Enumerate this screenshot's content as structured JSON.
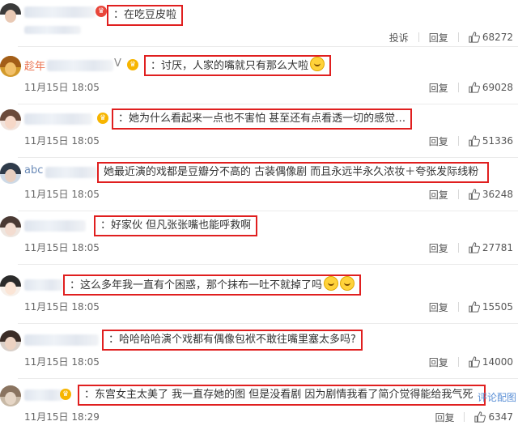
{
  "comments": [
    {
      "text": "在吃豆皮啦",
      "prefix": "：",
      "date": "",
      "likes": "68272",
      "show_report": true,
      "report": "投诉",
      "reply": "回复",
      "emoji": false
    },
    {
      "name": "趁年",
      "name_tail": "V",
      "text": "讨厌，人家的嘴就只有那么大啦",
      "prefix": "：",
      "date": "11月15日 18:05",
      "likes": "69028",
      "reply": "回复",
      "emoji": true
    },
    {
      "text": "她为什么看起来一点也不害怕 甚至还有点看透一切的感觉…",
      "prefix": "：",
      "date": "11月15日 18:05",
      "likes": "51336",
      "reply": "回复",
      "emoji": false
    },
    {
      "name": "abc",
      "text": "她最近演的戏都是豆瓣分不高的 古装偶像剧 而且永远半永久浓妆＋夸张发际线粉",
      "prefix": "",
      "date": "11月15日 18:05",
      "likes": "36248",
      "reply": "回复",
      "emoji": false
    },
    {
      "text": "好家伙 但凡张张嘴也能呼救啊",
      "prefix": "：",
      "date": "11月15日 18:05",
      "likes": "27781",
      "reply": "回复",
      "emoji": false
    },
    {
      "text": "这么多年我一直有个困惑，那个抹布一吐不就掉了吗",
      "prefix": "：",
      "date": "11月15日 18:05",
      "likes": "15505",
      "reply": "回复",
      "emoji": true
    },
    {
      "text": "哈哈哈哈演个戏都有偶像包袱不敢往嘴里塞太多吗?",
      "prefix": "：",
      "date": "11月15日 18:05",
      "likes": "14000",
      "reply": "回复",
      "emoji": false
    },
    {
      "text": "东宫女主太美了 我一直存她的图 但是没看剧 因为剧情我看了简介觉得能给我气死",
      "prefix": "：",
      "date": "11月15日 18:29",
      "likes": "6347",
      "reply": "回复",
      "emoji": false,
      "comment_pic": "评论配图"
    }
  ],
  "colors": {
    "highlight_border": "#e01f1f",
    "name": "#eb7350",
    "link": "#5a8fd6"
  },
  "icons": {
    "like": "thumbs-up-icon",
    "vip": "crown-icon"
  }
}
